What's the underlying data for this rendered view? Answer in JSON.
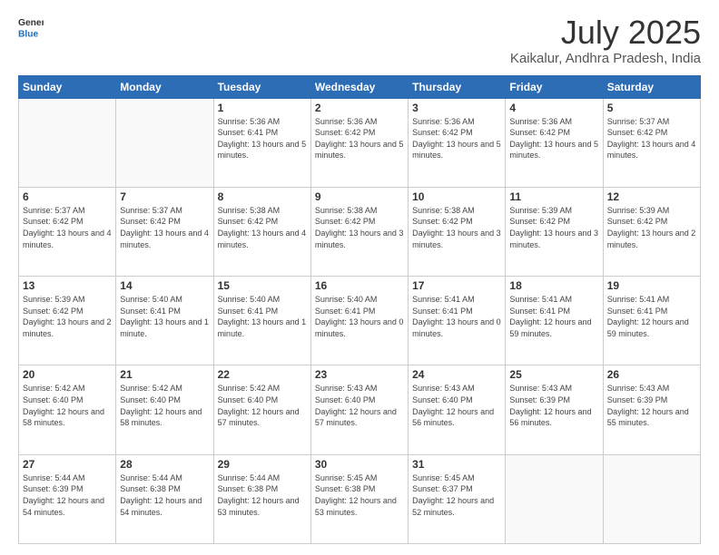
{
  "header": {
    "logo": {
      "general": "General",
      "blue": "Blue"
    },
    "title": "July 2025",
    "subtitle": "Kaikalur, Andhra Pradesh, India"
  },
  "weekdays": [
    "Sunday",
    "Monday",
    "Tuesday",
    "Wednesday",
    "Thursday",
    "Friday",
    "Saturday"
  ],
  "weeks": [
    [
      {
        "day": "",
        "empty": true
      },
      {
        "day": "",
        "empty": true
      },
      {
        "day": "1",
        "sunrise": "5:36 AM",
        "sunset": "6:41 PM",
        "daylight": "13 hours and 5 minutes."
      },
      {
        "day": "2",
        "sunrise": "5:36 AM",
        "sunset": "6:42 PM",
        "daylight": "13 hours and 5 minutes."
      },
      {
        "day": "3",
        "sunrise": "5:36 AM",
        "sunset": "6:42 PM",
        "daylight": "13 hours and 5 minutes."
      },
      {
        "day": "4",
        "sunrise": "5:36 AM",
        "sunset": "6:42 PM",
        "daylight": "13 hours and 5 minutes."
      },
      {
        "day": "5",
        "sunrise": "5:37 AM",
        "sunset": "6:42 PM",
        "daylight": "13 hours and 4 minutes."
      }
    ],
    [
      {
        "day": "6",
        "sunrise": "5:37 AM",
        "sunset": "6:42 PM",
        "daylight": "13 hours and 4 minutes."
      },
      {
        "day": "7",
        "sunrise": "5:37 AM",
        "sunset": "6:42 PM",
        "daylight": "13 hours and 4 minutes."
      },
      {
        "day": "8",
        "sunrise": "5:38 AM",
        "sunset": "6:42 PM",
        "daylight": "13 hours and 4 minutes."
      },
      {
        "day": "9",
        "sunrise": "5:38 AM",
        "sunset": "6:42 PM",
        "daylight": "13 hours and 3 minutes."
      },
      {
        "day": "10",
        "sunrise": "5:38 AM",
        "sunset": "6:42 PM",
        "daylight": "13 hours and 3 minutes."
      },
      {
        "day": "11",
        "sunrise": "5:39 AM",
        "sunset": "6:42 PM",
        "daylight": "13 hours and 3 minutes."
      },
      {
        "day": "12",
        "sunrise": "5:39 AM",
        "sunset": "6:42 PM",
        "daylight": "13 hours and 2 minutes."
      }
    ],
    [
      {
        "day": "13",
        "sunrise": "5:39 AM",
        "sunset": "6:42 PM",
        "daylight": "13 hours and 2 minutes."
      },
      {
        "day": "14",
        "sunrise": "5:40 AM",
        "sunset": "6:41 PM",
        "daylight": "13 hours and 1 minute."
      },
      {
        "day": "15",
        "sunrise": "5:40 AM",
        "sunset": "6:41 PM",
        "daylight": "13 hours and 1 minute."
      },
      {
        "day": "16",
        "sunrise": "5:40 AM",
        "sunset": "6:41 PM",
        "daylight": "13 hours and 0 minutes."
      },
      {
        "day": "17",
        "sunrise": "5:41 AM",
        "sunset": "6:41 PM",
        "daylight": "13 hours and 0 minutes."
      },
      {
        "day": "18",
        "sunrise": "5:41 AM",
        "sunset": "6:41 PM",
        "daylight": "12 hours and 59 minutes."
      },
      {
        "day": "19",
        "sunrise": "5:41 AM",
        "sunset": "6:41 PM",
        "daylight": "12 hours and 59 minutes."
      }
    ],
    [
      {
        "day": "20",
        "sunrise": "5:42 AM",
        "sunset": "6:40 PM",
        "daylight": "12 hours and 58 minutes."
      },
      {
        "day": "21",
        "sunrise": "5:42 AM",
        "sunset": "6:40 PM",
        "daylight": "12 hours and 58 minutes."
      },
      {
        "day": "22",
        "sunrise": "5:42 AM",
        "sunset": "6:40 PM",
        "daylight": "12 hours and 57 minutes."
      },
      {
        "day": "23",
        "sunrise": "5:43 AM",
        "sunset": "6:40 PM",
        "daylight": "12 hours and 57 minutes."
      },
      {
        "day": "24",
        "sunrise": "5:43 AM",
        "sunset": "6:40 PM",
        "daylight": "12 hours and 56 minutes."
      },
      {
        "day": "25",
        "sunrise": "5:43 AM",
        "sunset": "6:39 PM",
        "daylight": "12 hours and 56 minutes."
      },
      {
        "day": "26",
        "sunrise": "5:43 AM",
        "sunset": "6:39 PM",
        "daylight": "12 hours and 55 minutes."
      }
    ],
    [
      {
        "day": "27",
        "sunrise": "5:44 AM",
        "sunset": "6:39 PM",
        "daylight": "12 hours and 54 minutes."
      },
      {
        "day": "28",
        "sunrise": "5:44 AM",
        "sunset": "6:38 PM",
        "daylight": "12 hours and 54 minutes."
      },
      {
        "day": "29",
        "sunrise": "5:44 AM",
        "sunset": "6:38 PM",
        "daylight": "12 hours and 53 minutes."
      },
      {
        "day": "30",
        "sunrise": "5:45 AM",
        "sunset": "6:38 PM",
        "daylight": "12 hours and 53 minutes."
      },
      {
        "day": "31",
        "sunrise": "5:45 AM",
        "sunset": "6:37 PM",
        "daylight": "12 hours and 52 minutes."
      },
      {
        "day": "",
        "empty": true
      },
      {
        "day": "",
        "empty": true
      }
    ]
  ]
}
